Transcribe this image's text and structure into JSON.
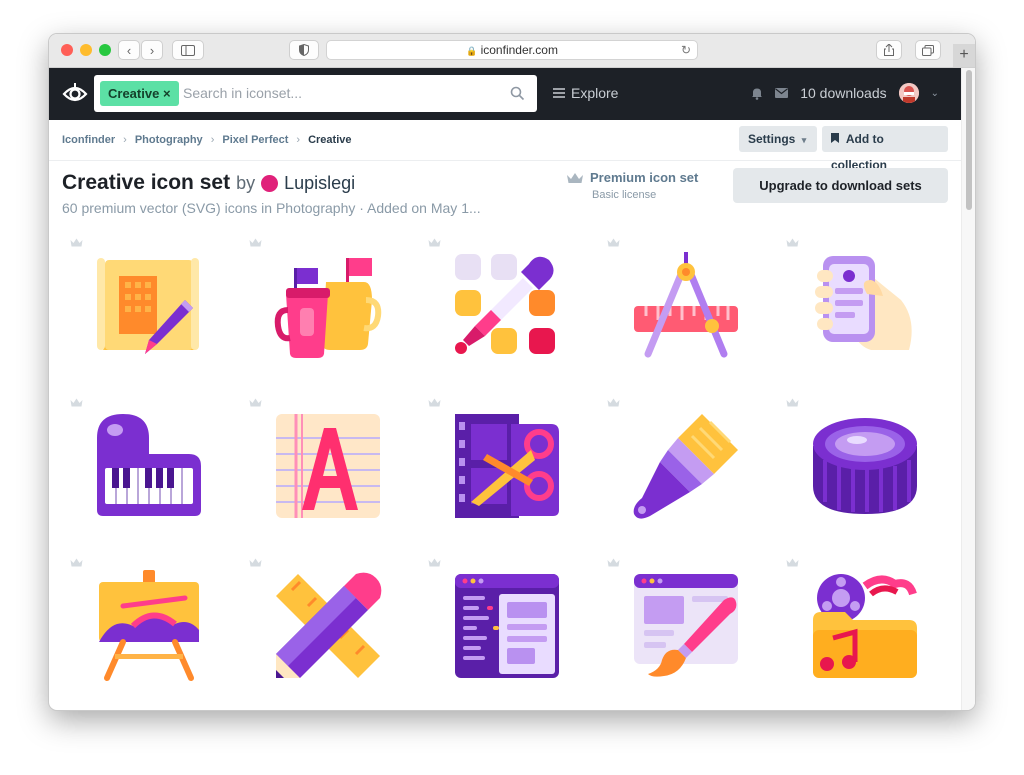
{
  "browser": {
    "url": "iconfinder.com",
    "colors": {
      "close": "#ff5f57",
      "minimize": "#febc2e",
      "zoom": "#28c840"
    }
  },
  "nav": {
    "search_tag": "Creative",
    "search_tag_close": "×",
    "search_placeholder": "Search in iconset...",
    "explore_label": "Explore",
    "downloads_label": "10 downloads"
  },
  "breadcrumbs": [
    "Iconfinder",
    "Photography",
    "Pixel Perfect",
    "Creative"
  ],
  "actions": {
    "settings_label": "Settings",
    "add_collection_label": "Add to collection",
    "upgrade_label": "Upgrade to download sets"
  },
  "iconset": {
    "title": "Creative icon set",
    "by": "by",
    "author": "Lupislegi",
    "subtitle": "60 premium vector (SVG) icons in Photography · Added on May 1...",
    "premium_title": "Premium icon set",
    "premium_license": "Basic license"
  },
  "icons": [
    {
      "name": "blueprint-pen-icon"
    },
    {
      "name": "paint-bucket-flags-icon"
    },
    {
      "name": "color-dropper-icon"
    },
    {
      "name": "compass-ruler-icon"
    },
    {
      "name": "phone-hand-icon"
    },
    {
      "name": "piano-keyboard-icon"
    },
    {
      "name": "typography-letter-icon"
    },
    {
      "name": "film-scissors-icon"
    },
    {
      "name": "paint-brush-icon"
    },
    {
      "name": "lens-cap-icon"
    },
    {
      "name": "easel-painting-icon"
    },
    {
      "name": "ruler-pencil-icon"
    },
    {
      "name": "code-window-icon"
    },
    {
      "name": "design-window-brush-icon"
    },
    {
      "name": "film-reel-music-folder-icon"
    }
  ]
}
